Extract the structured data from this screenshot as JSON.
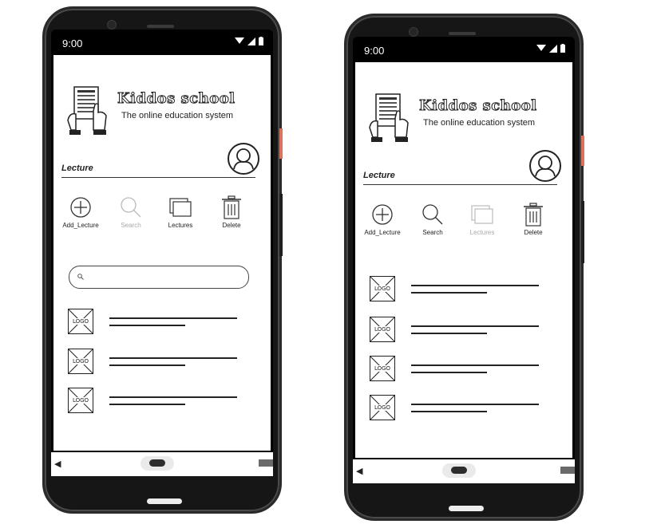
{
  "phones": [
    {
      "status_time": "9:00",
      "brand": "Kiddos school",
      "tagline": "The online education system",
      "section_title": "Lecture",
      "toolbar": [
        {
          "label": "Add_Lecture",
          "icon": "plus-circle-icon",
          "enabled": true
        },
        {
          "label": "Search",
          "icon": "search-icon",
          "enabled": false
        },
        {
          "label": "Lectures",
          "icon": "lectures-stack-icon",
          "enabled": true
        },
        {
          "label": "Delete",
          "icon": "trash-icon",
          "enabled": true
        }
      ],
      "search_bar_visible": true,
      "list_items": [
        {
          "thumb_label": "LOGO"
        },
        {
          "thumb_label": "LOGO"
        },
        {
          "thumb_label": "LOGO"
        }
      ]
    },
    {
      "status_time": "9:00",
      "brand": "Kiddos school",
      "tagline": "The online education system",
      "section_title": "Lecture",
      "toolbar": [
        {
          "label": "Add_Lecture",
          "icon": "plus-circle-icon",
          "enabled": true
        },
        {
          "label": "Search",
          "icon": "search-icon",
          "enabled": true
        },
        {
          "label": "Lectures",
          "icon": "lectures-stack-icon",
          "enabled": false
        },
        {
          "label": "Delete",
          "icon": "trash-icon",
          "enabled": true
        }
      ],
      "search_bar_visible": false,
      "list_items": [
        {
          "thumb_label": "LOGO"
        },
        {
          "thumb_label": "LOGO"
        },
        {
          "thumb_label": "LOGO"
        },
        {
          "thumb_label": "LOGO"
        }
      ]
    }
  ],
  "colors": {
    "phone_body": "#161616",
    "side_button_accent": "#d9735c",
    "screen_bg": "#ffffff",
    "disabled_text": "#aaaaaa"
  }
}
